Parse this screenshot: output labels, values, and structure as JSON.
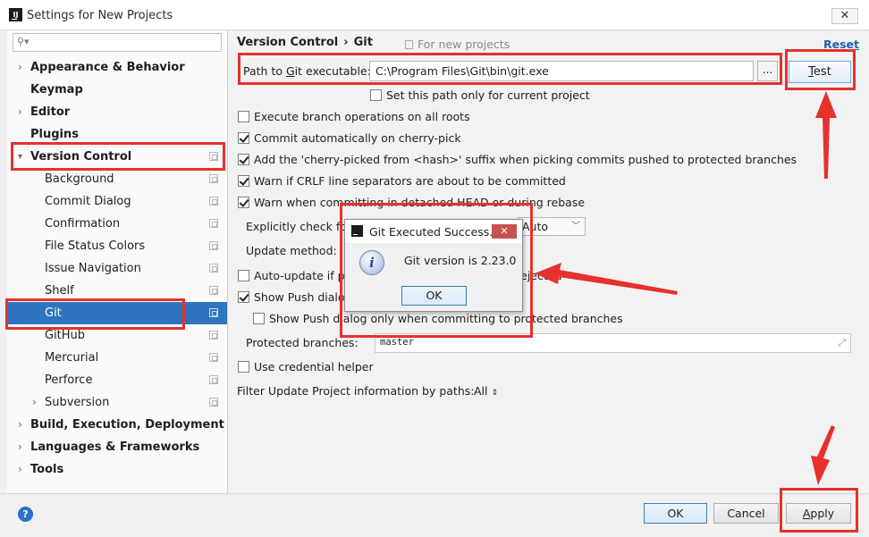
{
  "window": {
    "title": "Settings for New Projects",
    "close_glyph": "✕"
  },
  "sidebar": {
    "search_placeholder": "",
    "items": [
      {
        "label": "Appearance & Behavior",
        "bold": true,
        "arrow": true
      },
      {
        "label": "Keymap",
        "bold": true,
        "arrow": false
      },
      {
        "label": "Editor",
        "bold": true,
        "arrow": true
      },
      {
        "label": "Plugins",
        "bold": true,
        "arrow": false
      },
      {
        "label": "Version Control",
        "bold": true,
        "arrow": true,
        "expanded": true
      },
      {
        "label": "Background"
      },
      {
        "label": "Commit Dialog"
      },
      {
        "label": "Confirmation"
      },
      {
        "label": "File Status Colors"
      },
      {
        "label": "Issue Navigation"
      },
      {
        "label": "Shelf"
      },
      {
        "label": "Git",
        "selected": true
      },
      {
        "label": "GitHub"
      },
      {
        "label": "Mercurial"
      },
      {
        "label": "Perforce"
      },
      {
        "label": "Subversion",
        "arrow": true
      },
      {
        "label": "Build, Execution, Deployment",
        "bold": true,
        "arrow": true
      },
      {
        "label": "Languages & Frameworks",
        "bold": true,
        "arrow": true
      },
      {
        "label": "Tools",
        "bold": true,
        "arrow": true
      }
    ]
  },
  "content": {
    "breadcrumb": [
      "Version Control",
      "Git"
    ],
    "breadcrumb_sep": "›",
    "scope_note": "For new projects",
    "reset_label": "Reset",
    "path_label_pre": "Path to ",
    "path_label_mnemonic": "G",
    "path_label_post": "it executable:",
    "path_value": "C:\\Program Files\\Git\\bin\\git.exe",
    "browse_label": "...",
    "test_label_mnemonic": "T",
    "test_label_rest": "est",
    "current_project_only": "Set this path only for current project",
    "options": [
      {
        "label": "Execute branch operations on all roots",
        "checked": false
      },
      {
        "label": "Commit automatically on cherry-pick",
        "checked": true
      },
      {
        "label": "Add the 'cherry-picked from <hash>' suffix when picking commits pushed to protected branches",
        "checked": true
      },
      {
        "label": "Warn if CRLF line separators are about to be committed",
        "checked": true
      },
      {
        "label": "Warn when committing in detached HEAD or during rebase",
        "checked": true
      }
    ],
    "explicitly_check_label": "Explicitly check for incoming commits on remotes:",
    "explicitly_check_value": "Auto",
    "update_method_label": "Update method:",
    "auto_update_label": "Auto-update if push of the current branch was rejected",
    "auto_update_checked": false,
    "show_push_label": "Show Push dialog for Commit and Push",
    "show_push_checked": true,
    "show_push_protected_label": "Show Push dialog only when committing to protected branches",
    "show_push_protected_checked": false,
    "protected_branches_label": "Protected branches:",
    "protected_branches_value": "master",
    "credential_helper_label": "Use credential helper",
    "credential_helper_checked": false,
    "filter_label": "Filter Update Project information by paths:",
    "filter_value": "All"
  },
  "dialog": {
    "title": "Git Executed Success...",
    "message": "Git version is 2.23.0",
    "ok_label": "OK",
    "close_glyph": "✕",
    "info_glyph": "i"
  },
  "footer": {
    "help_glyph": "?",
    "ok_label": "OK",
    "cancel_label": "Cancel",
    "apply_label_mnemonic": "A",
    "apply_label_rest": "pply"
  },
  "colors": {
    "selection": "#2f74c0",
    "annotation_red": "#e6312d",
    "link_blue": "#1d60b5"
  }
}
